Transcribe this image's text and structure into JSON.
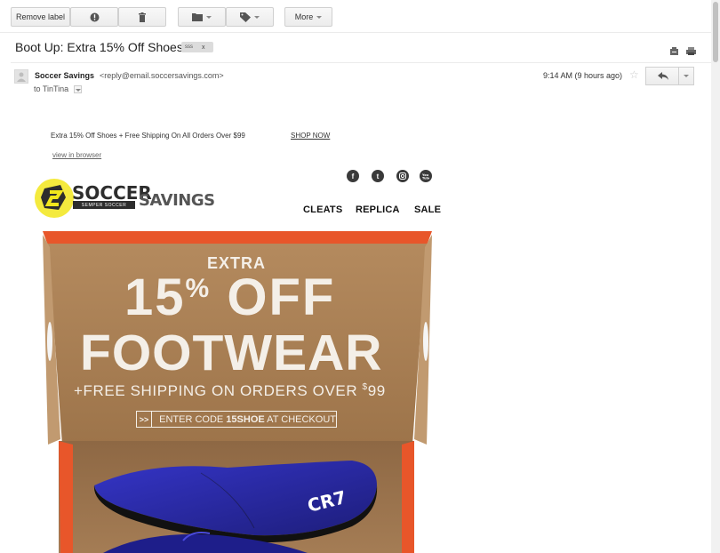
{
  "toolbar": {
    "remove_label": "Remove label",
    "more_label": "More"
  },
  "email": {
    "subject": "Boot Up: Extra 15% Off Shoes",
    "label_chip": "sss",
    "label_chip_close": "x",
    "sender_name": "Soccer Savings",
    "sender_email": "<reply@email.soccersavings.com>",
    "recipient": "to TinTina",
    "timestamp": "9:14 AM (9 hours ago)"
  },
  "body": {
    "preheader": "Extra 15% Off Shoes + Free Shipping On All Orders Over $99",
    "shop_now": "SHOP NOW",
    "view_in_browser": "view in browser",
    "logo": {
      "word1": "SOCCER",
      "word2": "SAVINGS",
      "tagline": "SEMPER SOCCER"
    },
    "social": [
      "f",
      "t",
      "ig",
      "yt"
    ],
    "nav": [
      "CLEATS",
      "REPLICA",
      "SALE"
    ],
    "hero": {
      "line1": "EXTRA",
      "line2_number": "15",
      "line2_pct": "%",
      "line2_off": "OFF",
      "line3": "FOOTWEAR",
      "line4": "+FREE SHIPPING ON ORDERS OVER ",
      "line4_price": "$",
      "line4_amount": "99",
      "code_arrows": ">>",
      "code_prefix": "ENTER CODE ",
      "code": "15SHOE",
      "code_suffix": " AT CHECKOUT",
      "shoe_text": "CR7"
    }
  },
  "colors": {
    "box_cardboard": "#a47a4f",
    "box_orange": "#e8562a",
    "shoe_blue": "#2b2ca8",
    "logo_yellow": "#f2e61c"
  },
  "icons": [
    "report-spam-icon",
    "trash-icon",
    "folder-icon",
    "tag-icon",
    "print-icon",
    "new-window-icon",
    "reply-icon",
    "star-icon"
  ]
}
